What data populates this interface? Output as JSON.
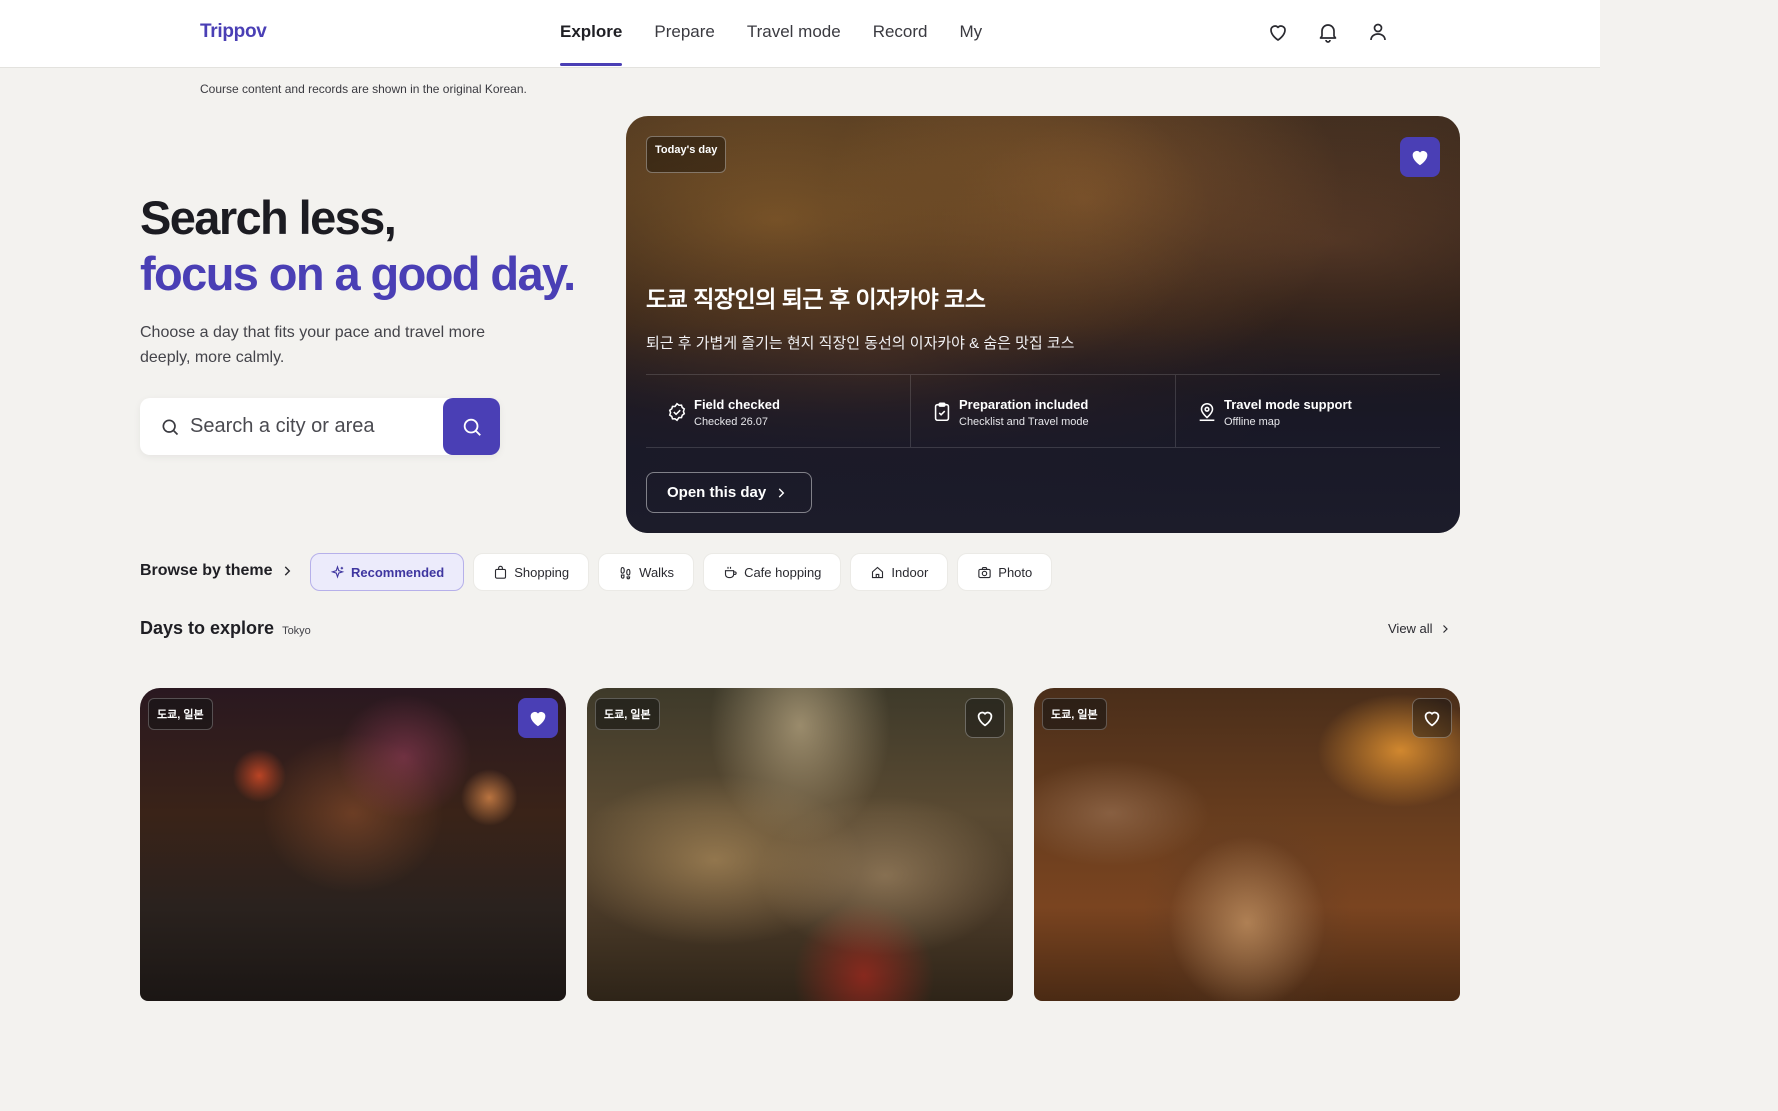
{
  "app": {
    "logo": "Trippov"
  },
  "nav": {
    "items": [
      {
        "label": "Explore"
      },
      {
        "label": "Prepare"
      },
      {
        "label": "Travel mode"
      },
      {
        "label": "Record"
      },
      {
        "label": "My"
      }
    ]
  },
  "header_icons": [
    "heart-icon",
    "bell-icon",
    "user-icon"
  ],
  "notice": "Course content and records are shown in the original Korean.",
  "hero": {
    "title_line1": "Search less,",
    "title_line2": "focus on a good day.",
    "subtitle": "Choose a day that fits your pace and travel more deeply, more calmly.",
    "search_placeholder": "Search a city or area"
  },
  "hero_card": {
    "badge": "Today's day",
    "title": "도쿄 직장인의 퇴근 후 이자카야 코스",
    "subtitle": "퇴근 후 가볍게 즐기는 현지 직장인 동선의 이자카야 & 숨은 맛집 코스",
    "stats": [
      {
        "title": "Field checked",
        "sub": "Checked 26.07",
        "icon": "check-circle-icon"
      },
      {
        "title": "Preparation included",
        "sub": "Checklist and Travel mode",
        "icon": "clipboard-check-icon"
      },
      {
        "title": "Travel mode support",
        "sub": "Offline map",
        "icon": "map-pin-icon"
      }
    ],
    "open_button": "Open this day"
  },
  "themes": {
    "label": "Browse by theme",
    "chips": [
      {
        "label": "Recommended",
        "icon": "sparkle-icon"
      },
      {
        "label": "Shopping",
        "icon": "shopping-bag-icon"
      },
      {
        "label": "Walks",
        "icon": "footprints-icon"
      },
      {
        "label": "Cafe hopping",
        "icon": "coffee-icon"
      },
      {
        "label": "Indoor",
        "icon": "home-icon"
      },
      {
        "label": "Photo",
        "icon": "camera-icon"
      }
    ]
  },
  "days": {
    "title": "Days to explore",
    "city": "Tokyo",
    "view_all": "View all",
    "cards": [
      {
        "badge": "도쿄, 일본",
        "favorited": true
      },
      {
        "badge": "도쿄, 일본",
        "favorited": false
      },
      {
        "badge": "도쿄, 일본",
        "favorited": false
      }
    ]
  },
  "colors": {
    "accent": "#4a3fb5",
    "background": "#f3f2ef",
    "chip_active_bg": "#ecebfb"
  }
}
